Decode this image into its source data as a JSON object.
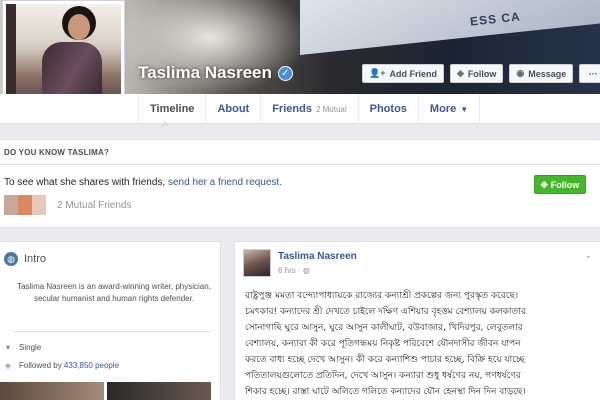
{
  "profile": {
    "name": "Taslima Nasreen",
    "verified_icon": "verified-check-icon"
  },
  "cover": {
    "banner_text": "ESS CA"
  },
  "cover_actions": {
    "add_friend": "Add Friend",
    "follow": "Follow",
    "message": "Message",
    "more": "···"
  },
  "nav": {
    "timeline": "Timeline",
    "about": "About",
    "friends": "Friends",
    "friends_sub": "2 Mutual",
    "photos": "Photos",
    "more": "More"
  },
  "know_box": {
    "title": "DO YOU KNOW TASLIMA?",
    "text_prefix": "To see what she shares with friends, ",
    "link": "send her a friend request.",
    "follow_button": "Follow",
    "mutual": "2 Mutual Friends"
  },
  "intro": {
    "title": "Intro",
    "bio": "Taslima Nasreen is an award-winning writer, physician, secular humanist and human rights defender.",
    "status": "Single",
    "followed_prefix": "Followed by ",
    "followed_count": "433,850 people"
  },
  "post": {
    "author": "Taslima Nasreen",
    "time": "6 hrs ·",
    "lines": [
      "রাষ্ট্রপুঞ্জ মমতা বন্দ্যোপাধ্যায়কে রাজ্যের কন্যাশ্রী প্রকল্পের জন্য পুরস্কৃত করেছে।",
      "চমৎকার! কন্যাদের শ্রী দেখতে চাইলে দক্ষিণ এশিয়ার বৃহত্তম বেশ্যালয় কলকাতার",
      "সোনাগাছি ঘুরে আসুন, ঘুরে আসুন কালীঘাট, বউবাজার, খিদিরপুর, লেবুতলার",
      "বেশ্যালয়, কন্যারা কী করে পূতিগন্ধময় নিকৃষ্ট পরিবেশে যৌনদাসীর জীবন যাপন",
      "করতে বাধ্য হচ্ছে দেখে আসুন। কী করে কন্যাশিশু পাচার হচ্ছে, বিক্রি হয়ে যাচ্ছে",
      "পতিতালয়গুলোতে প্রতিদিন, দেখে আসুন। কন্যারা শুধু ধর্ষণের নয়, গণধর্ষণের",
      "শিকার হচ্ছে। রাস্তা ঘাটে অলিতে গলিতে কন্যাদের যৌন হেনস্থা দিন দিন বাড়ছে।",
      "ঘরের ভেতর শত শত কন্যা প্রতিদিন স্বামী-শ্বশুরবাড়ির নির্যাতন সইছে দেখে"
    ]
  },
  "colors": {
    "link": "#365899",
    "follow_green": "#42b72a",
    "page_bg": "#e9ebee"
  }
}
